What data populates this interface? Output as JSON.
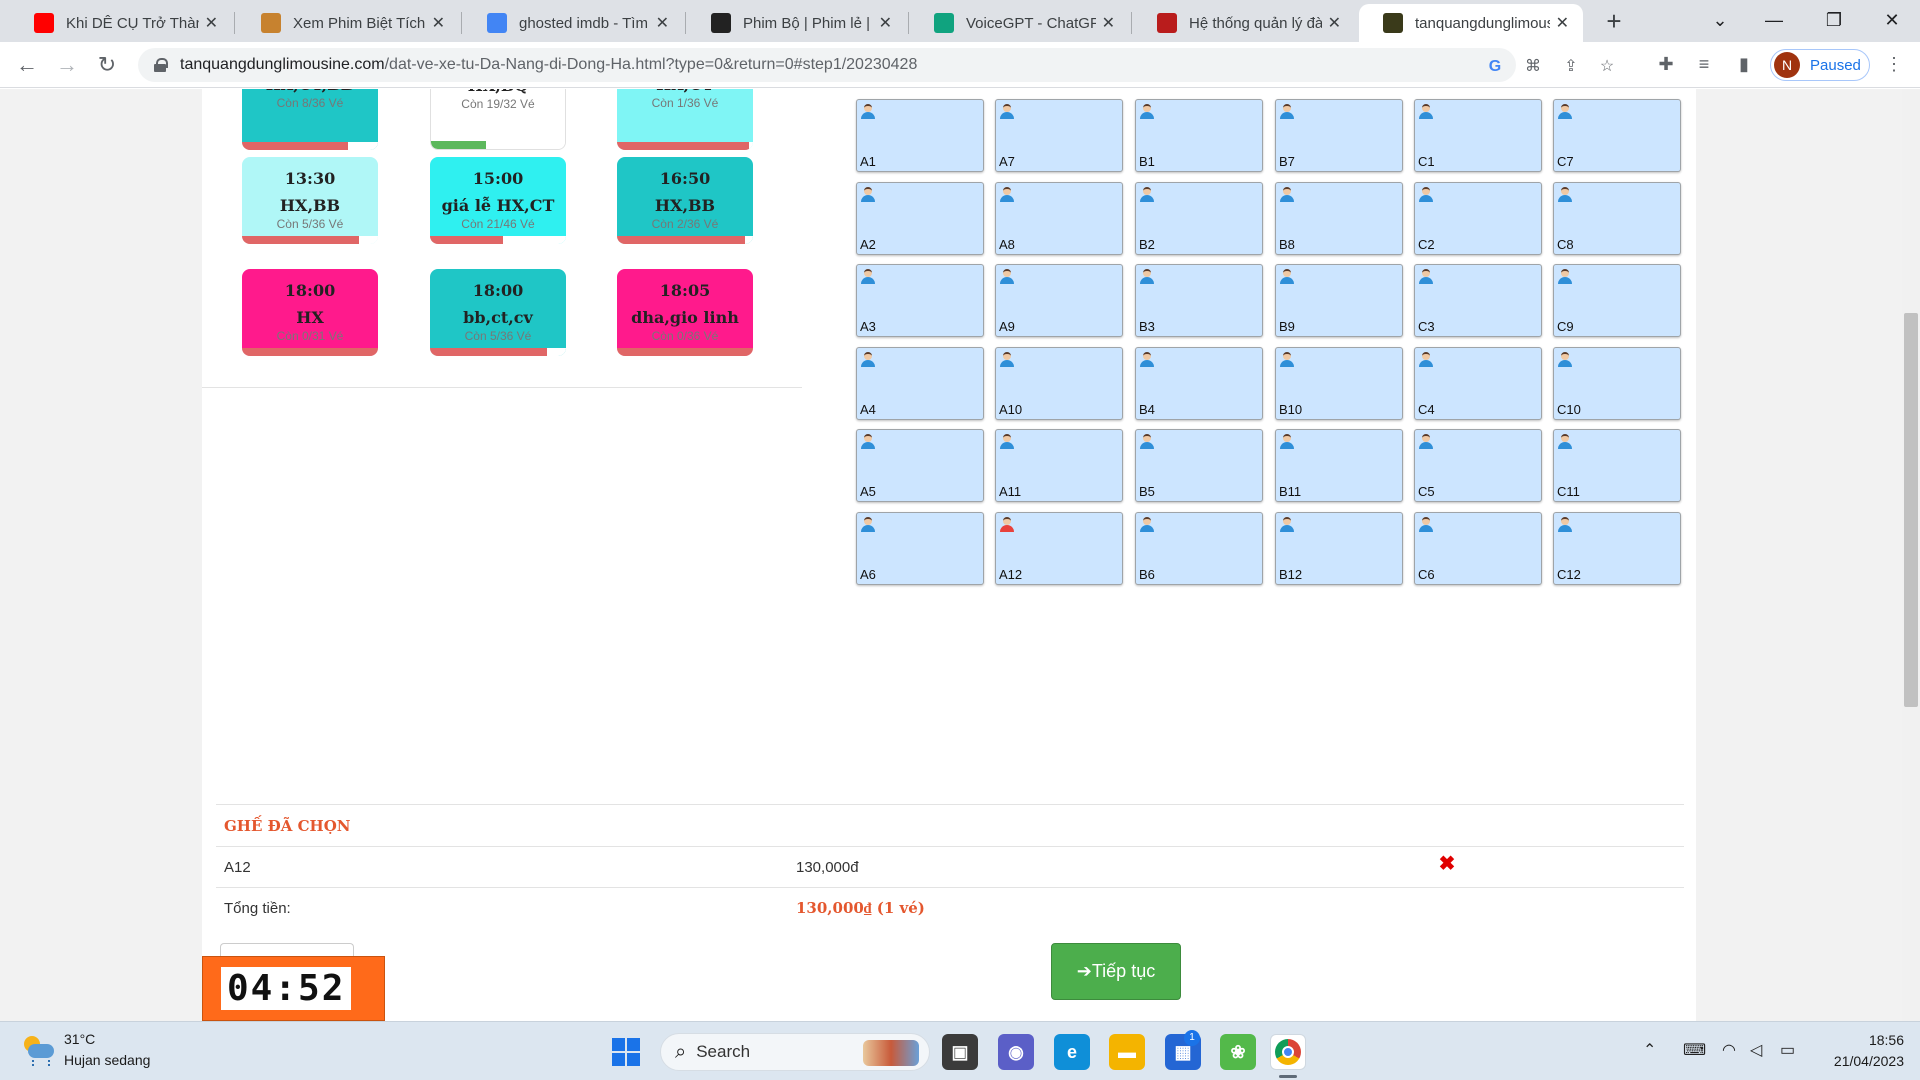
{
  "browser": {
    "tabs": [
      {
        "title": "Khi DÊ CỤ Trở Thành",
        "icon": "youtube-icon",
        "color": "#ff0000"
      },
      {
        "title": "Xem Phim Biệt Tích Fu",
        "icon": "hand-icon",
        "color": "#c7822f"
      },
      {
        "title": "ghosted imdb - Tìm tr",
        "icon": "google-icon",
        "color": "#4285f4"
      },
      {
        "title": "Phim Bộ | Phim lẻ | Ph",
        "icon": "phimbo-icon",
        "color": "#222222"
      },
      {
        "title": "VoiceGPT - ChatGPT v",
        "icon": "chatgpt-icon",
        "color": "#10a37f"
      },
      {
        "title": "Hệ thống quản lý đào",
        "icon": "vlu-icon",
        "color": "#b91c1c"
      },
      {
        "title": "tanquangdunglimous",
        "icon": "limousine-icon",
        "color": "#3a3a1a"
      }
    ],
    "url_domain": "tanquangdunglimousine.com",
    "url_path": "/dat-ve-xe-tu-Da-Nang-di-Dong-Ha.html?type=0&return=0#step1/20230428",
    "profile_initial": "N",
    "profile_status": "Paused"
  },
  "trips": [
    {
      "time": "",
      "route": "HX,CT,BB",
      "remain": "Còn 8/36 Vé",
      "color": "#1fc6c6",
      "fill": 0.78,
      "fill_color": "#e06666"
    },
    {
      "time": "",
      "route": "HX,BQ",
      "remain": "Còn 19/32 Vé",
      "color": "#ffffff",
      "fill": 0.41,
      "fill_color": "#5cb85c"
    },
    {
      "time": "",
      "route": "HX,CT",
      "remain": "Còn 1/36 Vé",
      "color": "#7ff5f5",
      "fill": 0.97,
      "fill_color": "#e06666"
    },
    {
      "time": "13:30",
      "route": "HX,BB",
      "remain": "Còn 5/36 Vé",
      "color": "#b0f7f7",
      "fill": 0.86,
      "fill_color": "#e06666"
    },
    {
      "time": "15:00",
      "route": "giá lễ HX,CT",
      "remain": "Còn 21/46 Vé",
      "color": "#2ff0f0",
      "fill": 0.54,
      "fill_color": "#e06666"
    },
    {
      "time": "16:50",
      "route": "HX,BB",
      "remain": "Còn 2/36 Vé",
      "color": "#1fc6c6",
      "fill": 0.94,
      "fill_color": "#e06666"
    },
    {
      "time": "18:00",
      "route": "HX",
      "remain": "Còn 0/31 Vé",
      "color": "#ff1a8c",
      "fill": 1.0,
      "fill_color": "#e06666"
    },
    {
      "time": "18:00",
      "route": "bb,ct,cv",
      "remain": "Còn 5/36 Vé",
      "color": "#1fc6c6",
      "fill": 0.86,
      "fill_color": "#e06666"
    },
    {
      "time": "18:05",
      "route": "dha,gio linh",
      "remain": "Còn 0/36 Vé",
      "color": "#ff1a8c",
      "fill": 1.0,
      "fill_color": "#e06666"
    }
  ],
  "seats": [
    [
      "A1",
      "A7",
      "B1",
      "B7",
      "C1",
      "C7"
    ],
    [
      "A2",
      "A8",
      "B2",
      "B8",
      "C2",
      "C8"
    ],
    [
      "A3",
      "A9",
      "B3",
      "B9",
      "C3",
      "C9"
    ],
    [
      "A4",
      "A10",
      "B4",
      "B10",
      "C4",
      "C10"
    ],
    [
      "A5",
      "A11",
      "B5",
      "B11",
      "C5",
      "C11"
    ],
    [
      "A6",
      "A12",
      "B6",
      "B12",
      "C6",
      "C12"
    ]
  ],
  "selected_seat_highlight": "A12",
  "selection": {
    "title": "GHẾ ĐÃ CHỌN",
    "items": [
      {
        "seat": "A12",
        "price": "130,000đ"
      }
    ],
    "total_label": "Tổng tiền:",
    "total_value": "130,000₫ (1 vé)",
    "continue_label": "➔Tiếp tục"
  },
  "timer": "04:52",
  "taskbar": {
    "temp": "31°C",
    "weather": "Hujan sedang",
    "search": "Search",
    "notification_count": "1",
    "time": "18:56",
    "date": "21/04/2023"
  }
}
